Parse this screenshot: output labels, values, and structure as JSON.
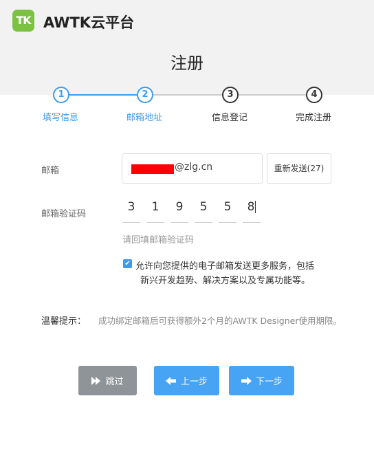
{
  "header": {
    "logo_text": "TK",
    "brand": "AWTK云平台",
    "title": "注册"
  },
  "steps": [
    {
      "number": "1",
      "label": "填写信息",
      "state": "done"
    },
    {
      "number": "2",
      "label": "邮箱地址",
      "state": "active"
    },
    {
      "number": "3",
      "label": "信息登记",
      "state": "pending"
    },
    {
      "number": "4",
      "label": "完成注册",
      "state": "pending"
    }
  ],
  "form": {
    "email_label": "邮箱",
    "email_suffix": "@zlg.cn",
    "resend_label": "重新发送(27)",
    "code_label": "邮箱验证码",
    "code_digits": [
      "3",
      "1",
      "9",
      "5",
      "5",
      "8"
    ],
    "code_hint": "请回填邮箱验证码",
    "consent_checked": true,
    "consent_line1": "允许向您提供的电子邮箱发送更多服务，包括",
    "consent_line2": "新兴开发趋势、解决方案以及专属功能等。"
  },
  "tip": {
    "label": "温馨提示：",
    "text": "成功绑定邮箱后可获得额外2个月的AWTK Designer使用期限。"
  },
  "buttons": {
    "skip": "跳过",
    "prev": "上一步",
    "next": "下一步"
  },
  "colors": {
    "accent": "#3d9be9",
    "button_blue": "#47a3f3",
    "button_gray": "#8f9499",
    "logo_green": "#7cc242"
  }
}
